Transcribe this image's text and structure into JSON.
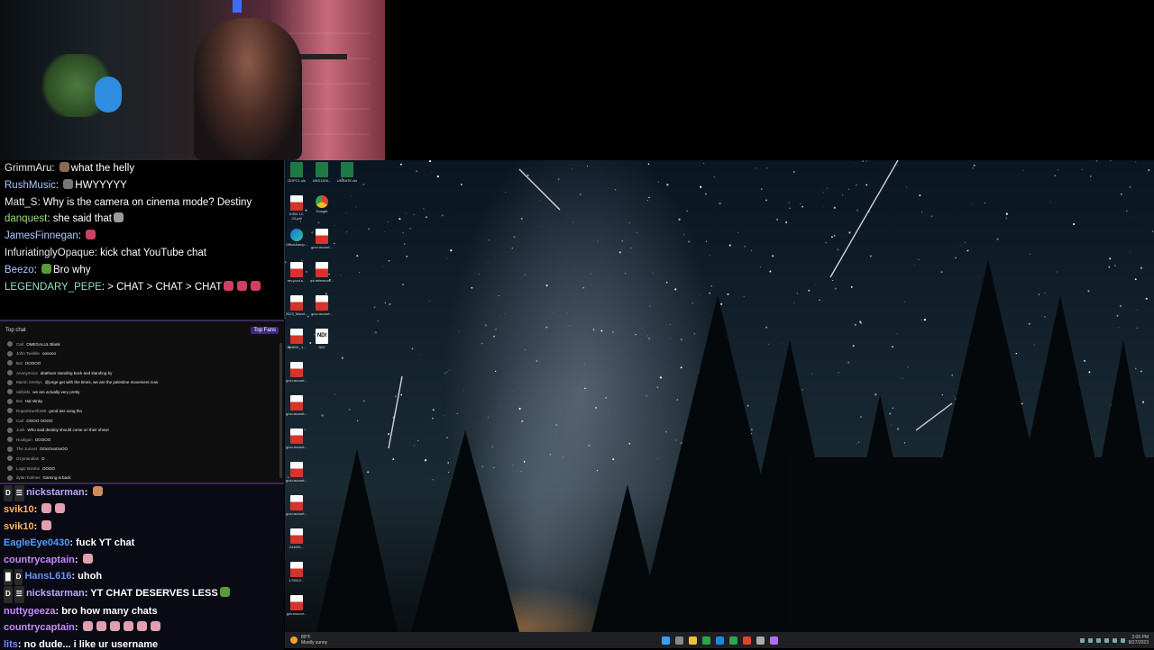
{
  "twitch_chat": [
    {
      "user": "GrimmAru",
      "color": "#e8e8e8",
      "text": "what the helly",
      "emotes": [
        "#8a6a55"
      ],
      "emote_first": true
    },
    {
      "user": "RushMusic",
      "color": "#a9c9ff",
      "text": "HWYYYYY",
      "emotes": [
        "#777"
      ],
      "emote_first": true
    },
    {
      "user": "Matt_S",
      "color": "#e8e8e8",
      "text": "Why is the camera on cinema mode? Destiny",
      "emotes": []
    },
    {
      "user": "danquest",
      "color": "#9de07a",
      "text": "she said that",
      "emotes": [
        "#999"
      ]
    },
    {
      "user": "JamesFinnegan",
      "color": "#a9c9ff",
      "text": "",
      "emotes": [
        "#d04060"
      ]
    },
    {
      "user": "InfuriatinglyOpaque",
      "color": "#e8e8e8",
      "text": "kick chat   YouTube chat",
      "emotes": []
    },
    {
      "user": "Beezo",
      "color": "#a9c9ff",
      "text": "Bro why",
      "emotes": [
        "#5a9a3a"
      ],
      "emote_first": true
    },
    {
      "user": "LEGENDARY_PEPE",
      "color": "#8fe0c0",
      "text": "> CHAT > CHAT > CHAT",
      "emotes": [
        "#d04060",
        "#d04060",
        "#d04060"
      ]
    }
  ],
  "yt_chat": {
    "header": "Top chat",
    "top_fans": "Top Fans",
    "messages": [
      {
        "author": "Carl",
        "text": "OMEGALUL Blank"
      },
      {
        "author": "John Twinkle",
        "text": "oooooo"
      },
      {
        "author": "Bot",
        "text": "OOOOO"
      },
      {
        "author": "Anonymous",
        "text": "abathurs standing back and standing by"
      },
      {
        "author": "Martin Smelyn",
        "text": "@jorge get with the times, we are the palestine movement now"
      },
      {
        "author": "nikfolds",
        "text": "we are actually very pretty"
      },
      {
        "author": "Bot",
        "text": "Hal stinky"
      },
      {
        "author": "Rupamkumfor56",
        "text": "good ass song tho"
      },
      {
        "author": "Carl",
        "text": "OOOO OOOO"
      },
      {
        "author": "Josh",
        "text": "Who said destiny should come on their show!"
      },
      {
        "author": "Hooligon",
        "text": "OOOOO"
      },
      {
        "author": "The Juicest",
        "text": "OOoOooOoOO"
      },
      {
        "author": "Ozymandias",
        "text": "O"
      },
      {
        "author": "Logic Bombs",
        "text": "OOOO"
      },
      {
        "author": "dylan holmes",
        "text": "Gaming is back"
      }
    ]
  },
  "combined_chat": [
    {
      "badges": [
        "D",
        "☰"
      ],
      "user": "nickstarman",
      "color": "#b9a7ff",
      "text": "",
      "emotes": [
        "#d08a5a"
      ]
    },
    {
      "badges": [],
      "user": "svik10",
      "color": "#ffb25a",
      "text": "",
      "emotes": [
        "#e0a0b0",
        "#e0a0b0"
      ]
    },
    {
      "badges": [],
      "user": "svik10",
      "color": "#ffb25a",
      "text": "",
      "emotes": [
        "#e0a0b0"
      ]
    },
    {
      "badges": [],
      "user": "EagleEye0430",
      "color": "#4f9fff",
      "text": "fuck YT chat",
      "emotes": []
    },
    {
      "badges": [],
      "user": "countrycaptain",
      "color": "#c88aff",
      "text": "",
      "emotes": [
        "#e0a0b0"
      ]
    },
    {
      "badges": [
        "█",
        "D"
      ],
      "user": "HansL616",
      "color": "#6a90ff",
      "text": "uhoh",
      "emotes": []
    },
    {
      "badges": [
        "D",
        "☰"
      ],
      "user": "nickstarman",
      "color": "#b9a7ff",
      "text": "YT CHAT DESERVES LESS",
      "emotes": [
        "#5a9a3a"
      ]
    },
    {
      "badges": [],
      "user": "nuttygeeza",
      "color": "#c88aff",
      "text": "bro how many chats",
      "emotes": []
    },
    {
      "badges": [],
      "user": "countrycaptain",
      "color": "#c88aff",
      "text": "",
      "emotes": [
        "#e0a0b0",
        "#e0a0b0",
        "#e0a0b0",
        "#e0a0b0",
        "#e0a0b0",
        "#e0a0b0"
      ]
    },
    {
      "badges": [],
      "user": "lits",
      "color": "#6a90ff",
      "text": "no dude... i like ur username",
      "emotes": []
    }
  ],
  "desktop_icons": [
    {
      "label": "GDPC1.xls",
      "type": "xls"
    },
    {
      "label": "UNS1200...",
      "type": "xls"
    },
    {
      "label": "UNRATE.xls",
      "type": "xls"
    },
    {
      "label": "IHSN 12-23.pdf",
      "type": "pdf"
    },
    {
      "label": "Google",
      "type": "chrome"
    },
    {
      "label": "Office&amp...",
      "type": "edge"
    },
    {
      "label": "gov.uscourt...",
      "type": "pdf"
    },
    {
      "label": "rev.pool.s...",
      "type": "pdf"
    },
    {
      "label": "rpt.reference...",
      "type": "pdf"
    },
    {
      "label": "2023_Mand...",
      "type": "pdf"
    },
    {
      "label": "gov.uscourt...",
      "type": "pdf"
    },
    {
      "label": "244651_1...",
      "type": "pdf"
    },
    {
      "label": "NDI",
      "type": "ndi"
    },
    {
      "label": "gov.uscourt...",
      "type": "pdf"
    },
    {
      "label": "gov.uscourt...",
      "type": "pdf"
    },
    {
      "label": "gov.uscourt...",
      "type": "pdf"
    },
    {
      "label": "gov.uscourt...",
      "type": "pdf"
    },
    {
      "label": "gov.uscourt...",
      "type": "pdf"
    },
    {
      "label": "244651...",
      "type": "pdf"
    },
    {
      "label": "170512...",
      "type": "pdf"
    },
    {
      "label": "gov.uscour...",
      "type": "pdf"
    }
  ],
  "taskbar": {
    "weather_temp": "89°F",
    "weather_desc": "Mostly sunny",
    "time": "2:06 PM",
    "date": "8/27/2023",
    "center_colors": [
      "#3aa0ff",
      "#888",
      "#f0c040",
      "#2da44e",
      "#1a88e0",
      "#2da44e",
      "#e34133",
      "#aaa",
      "#b070ff"
    ]
  }
}
